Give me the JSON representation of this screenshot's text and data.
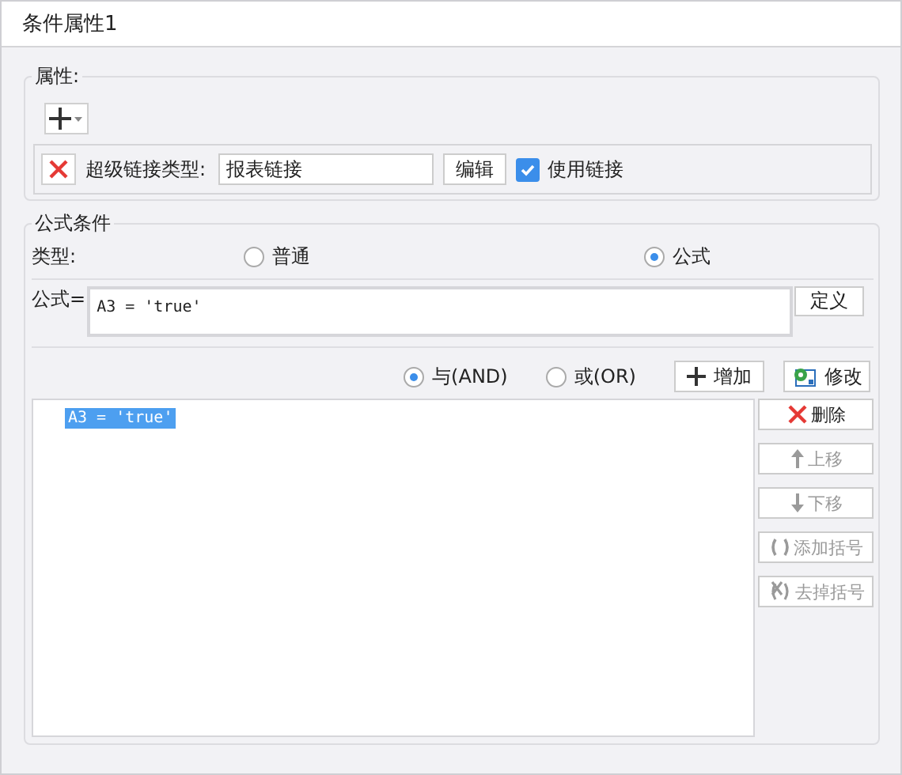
{
  "window": {
    "title": "条件属性1"
  },
  "properties": {
    "legend": "属性:",
    "link_type_label": "超级链接类型:",
    "link_type_value": "报表链接",
    "edit_button": "编辑",
    "use_link": {
      "label": "使用链接",
      "checked": true
    }
  },
  "formula_condition": {
    "legend": "公式条件",
    "type_label": "类型:",
    "type_options": [
      {
        "label": "普通",
        "selected": false
      },
      {
        "label": "公式",
        "selected": true
      }
    ],
    "formula_label": "公式=",
    "formula_value": "A3 = 'true'",
    "define_button": "定义",
    "logic_options": [
      {
        "label": "与(AND)",
        "selected": true
      },
      {
        "label": "或(OR)",
        "selected": false
      }
    ],
    "add_button": "增加",
    "modify_button": "修改",
    "conditions": [
      {
        "text": "A3 = 'true'",
        "selected": true
      }
    ],
    "side_buttons": [
      {
        "label": "删除",
        "kind": "delete",
        "disabled": false
      },
      {
        "label": "上移",
        "kind": "up",
        "disabled": true
      },
      {
        "label": "下移",
        "kind": "down",
        "disabled": true
      },
      {
        "label": "添加括号",
        "kind": "add-brackets",
        "disabled": true
      },
      {
        "label": "去掉括号",
        "kind": "remove-brackets",
        "disabled": true
      }
    ]
  }
}
